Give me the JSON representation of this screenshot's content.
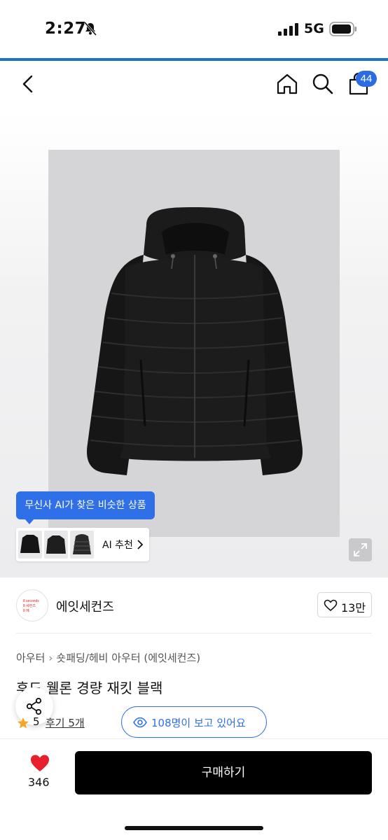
{
  "status_bar": {
    "time": "2:27",
    "network": "5G",
    "icons": [
      "bell-slash-icon",
      "signal-icon",
      "battery-icon"
    ]
  },
  "nav": {
    "icons": [
      "back-icon",
      "home-icon",
      "search-icon",
      "cart-icon"
    ],
    "cart_count": "44"
  },
  "hero": {
    "tooltip": "무신사 AI가 찾은 비슷한 상품",
    "ai_recommend_label": "AI 추천",
    "thumbnail_count": 3
  },
  "brand": {
    "logo_text": [
      "8 seconds",
      "8 세컨즈",
      "8 에"
    ],
    "name": "에잇세컨즈",
    "like_count": "13만"
  },
  "breadcrumb": [
    "아우터",
    "숏패딩/헤비 아우터",
    "(에잇세컨즈)"
  ],
  "product": {
    "title": "후드 웰론 경량 재킷 블랙",
    "rating": "5",
    "reviews": "후기 5개"
  },
  "viewers": "108명이 보고 있어요",
  "bottom_bar": {
    "wish_count": "346",
    "buy_label": "구매하기"
  },
  "colors": {
    "accent": "#2f6fe8",
    "header_line": "#1a73c9",
    "heart": "#e8202e",
    "buy_button": "#000000"
  }
}
